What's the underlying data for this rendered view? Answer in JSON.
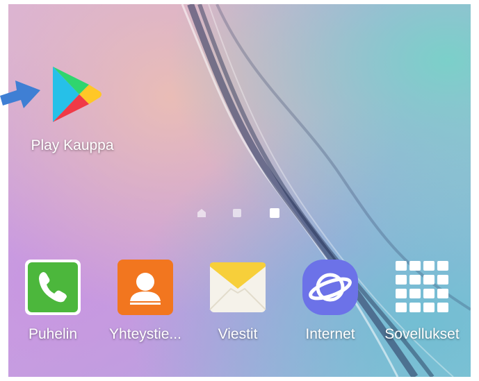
{
  "home": {
    "play_store": {
      "label": "Play Kauppa",
      "icon": "google-play-icon"
    },
    "page_indicator": {
      "pages": 3,
      "current": 3
    }
  },
  "dock": [
    {
      "label": "Puhelin",
      "icon": "phone-icon"
    },
    {
      "label": "Yhteystie...",
      "icon": "contacts-icon"
    },
    {
      "label": "Viestit",
      "icon": "messages-icon"
    },
    {
      "label": "Internet",
      "icon": "internet-browser-icon"
    },
    {
      "label": "Sovellukset",
      "icon": "apps-grid-icon"
    }
  ],
  "colors": {
    "arrow": "#3f7fd4",
    "phone": "#4cb73c",
    "contacts": "#f2761f",
    "messages": "#f7cf3a",
    "internet": "#6c72e8"
  }
}
